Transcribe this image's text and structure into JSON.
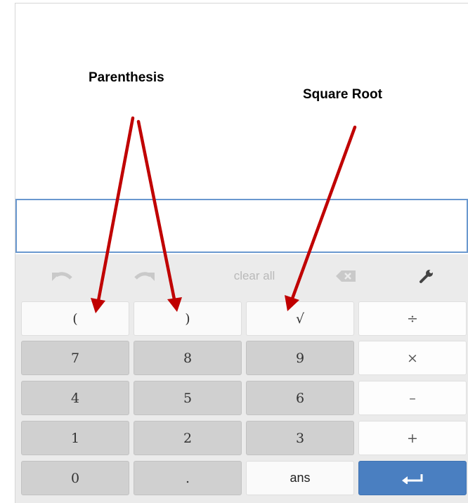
{
  "annotations": {
    "parenthesis": "Parenthesis",
    "square_root": "Square Root"
  },
  "toolbar": {
    "undo_icon": "undo-arrow-icon",
    "redo_icon": "redo-arrow-icon",
    "clear_all": "clear all",
    "backspace_icon": "backspace-icon",
    "settings_icon": "wrench-icon"
  },
  "keys": {
    "open_paren": "(",
    "close_paren": ")",
    "sqrt": "√",
    "divide": "÷",
    "seven": "7",
    "eight": "8",
    "nine": "9",
    "multiply": "×",
    "four": "4",
    "five": "5",
    "six": "6",
    "minus": "–",
    "one": "1",
    "two": "2",
    "three": "3",
    "plus": "+",
    "zero": "0",
    "decimal": ".",
    "ans": "ans",
    "enter_icon": "enter-return-icon"
  },
  "colors": {
    "arrow": "#c00000",
    "display_border": "#6a98cf",
    "enter_key": "#4a7fc1"
  }
}
